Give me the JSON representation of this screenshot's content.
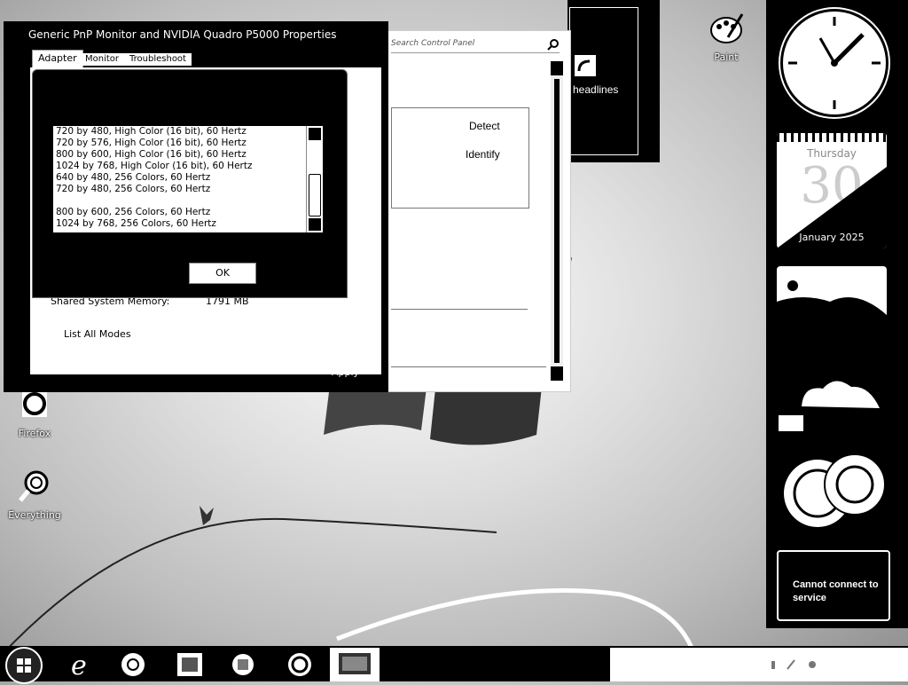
{
  "desktop": {
    "icons": [
      {
        "label": "Paint"
      },
      {
        "label": "Firefox"
      },
      {
        "label": "Everything"
      }
    ]
  },
  "properties_window": {
    "title": "Generic PnP Monitor and NVIDIA Quadro P5000 Properties",
    "tabs": [
      "Adapter",
      "Monitor",
      "Troubleshoot"
    ],
    "shared_memory_label": "Shared System Memory:",
    "shared_memory_value": "1791 MB",
    "list_all_modes_label": "List All Modes",
    "apply_label": "Apply"
  },
  "modes_dialog": {
    "modes": [
      "720 by 480, High Color (16 bit), 60 Hertz",
      "720 by 576, High Color (16 bit), 60 Hertz",
      "800 by 600, High Color (16 bit), 60 Hertz",
      "1024 by 768, High Color (16 bit), 60 Hertz",
      "640 by 480, 256 Colors, 60 Hertz",
      "720 by 480, 256 Colors, 60 Hertz",
      "",
      "800 by 600, 256 Colors, 60 Hertz",
      "1024 by 768, 256 Colors, 60 Hertz"
    ],
    "ok_label": "OK"
  },
  "screen_resolution": {
    "search_placeholder": "Search Control Panel",
    "detect_label": "Detect",
    "identify_label": "Identify"
  },
  "gadgets": {
    "news_text": "headlines",
    "calendar": {
      "day": "Thursday",
      "date": "30",
      "month_year": "January 2025"
    },
    "sync_message": "Cannot connect to service"
  }
}
